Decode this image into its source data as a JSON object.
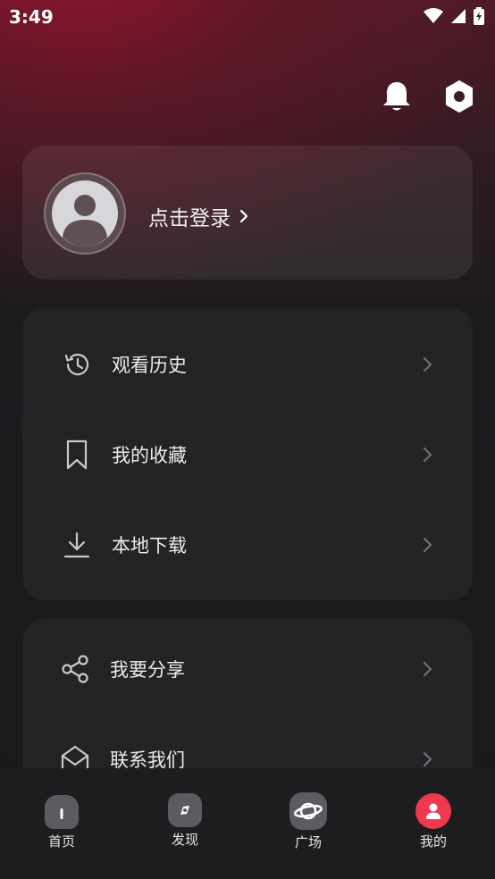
{
  "status_bar": {
    "time": "3:49"
  },
  "header": {
    "bell_icon": "bell-icon",
    "settings_icon": "settings-hex-icon"
  },
  "login": {
    "label": "点击登录",
    "avatar_icon": "avatar-icon"
  },
  "menu_group_1": [
    {
      "label": "观看历史",
      "icon": "history-icon"
    },
    {
      "label": "我的收藏",
      "icon": "bookmark-icon"
    },
    {
      "label": "本地下载",
      "icon": "download-icon"
    }
  ],
  "menu_group_2": [
    {
      "label": "我要分享",
      "icon": "share-icon"
    },
    {
      "label": "联系我们",
      "icon": "mail-open-icon"
    }
  ],
  "tabs": [
    {
      "label": "首页",
      "icon": "home-icon"
    },
    {
      "label": "发现",
      "icon": "compass-icon"
    },
    {
      "label": "广场",
      "icon": "planet-icon"
    },
    {
      "label": "我的",
      "icon": "profile-icon",
      "active": true
    }
  ],
  "colors": {
    "accent": "#f0394f",
    "card": "#232326",
    "background": "#19191b"
  }
}
